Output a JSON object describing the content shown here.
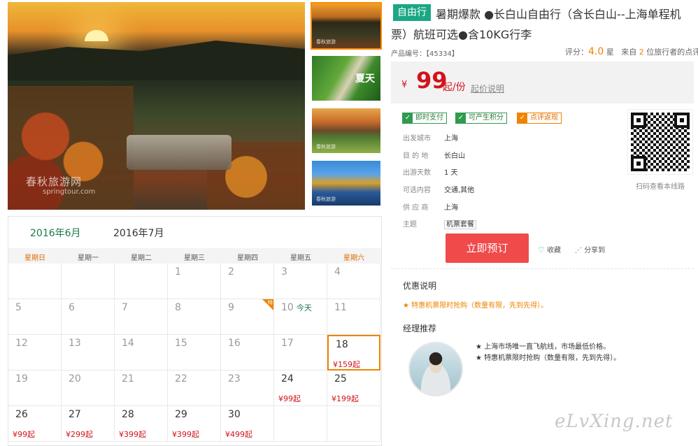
{
  "gallery": {
    "main_watermark": "春秋旅游网",
    "main_watermark_sub": "springtour.com",
    "thumbs": [
      {
        "name": "sunset-mountain",
        "wm": "春秋旅游"
      },
      {
        "name": "forest-boardwalk",
        "wm": "",
        "text": "夏天"
      },
      {
        "name": "golf-field",
        "wm": "春秋旅游"
      },
      {
        "name": "autumn-lake",
        "wm": "春秋旅游"
      }
    ]
  },
  "product": {
    "tag": "自由行",
    "title": "暑期爆款 ●长白山自由行（含长白山--上海单程机票）航班可选●含10KG行李",
    "id_label": "产品编号：【45334】",
    "rating_label": "评分：",
    "rating_value": "4.0",
    "rating_unit": "星",
    "rating_from": "来自",
    "rating_count": "2",
    "rating_suffix": "位旅行者的点评"
  },
  "price": {
    "currency": "¥",
    "amount": "99",
    "unit": "起/份",
    "explain_link": "起价说明"
  },
  "badges": [
    {
      "label": "即时支付",
      "color": "green"
    },
    {
      "label": "可产生积分",
      "color": "green"
    },
    {
      "label": "点评返现",
      "color": "orange"
    }
  ],
  "info": [
    {
      "key": "出发城市",
      "value": "上海"
    },
    {
      "key": "目 的 地",
      "value": "长白山"
    },
    {
      "key": "出游天数",
      "value": "1 天"
    },
    {
      "key": "可选内容",
      "value": "交通,其他"
    },
    {
      "key": "供 应 商",
      "value": "上海"
    },
    {
      "key": "主题",
      "value": "机票套餐"
    }
  ],
  "qr_label": "扫码查看本线路",
  "actions": {
    "book": "立即预订",
    "favorite": "收藏",
    "share": "分享到"
  },
  "promo": {
    "title": "优惠说明",
    "text": "★ 特惠机票限时抢购（数量有限，先到先得）。"
  },
  "manager": {
    "title": "经理推荐",
    "lines": [
      "★ 上海市场唯一直飞航线，市场最低价格。",
      "★ 特惠机票限时抢购（数量有限，先到先得）。"
    ]
  },
  "watermark": "eLvXing.net",
  "calendar": {
    "tabs": [
      "2016年6月",
      "2016年7月"
    ],
    "active_tab": 0,
    "weekdays": [
      "星期日",
      "星期一",
      "星期二",
      "星期三",
      "星期四",
      "星期五",
      "星期六"
    ],
    "today_label": "今天",
    "hot_tag": "特",
    "rows": [
      [
        {
          "d": ""
        },
        {
          "d": ""
        },
        {
          "d": ""
        },
        {
          "d": "1"
        },
        {
          "d": "2"
        },
        {
          "d": "3"
        },
        {
          "d": "4"
        }
      ],
      [
        {
          "d": "5"
        },
        {
          "d": "6"
        },
        {
          "d": "7"
        },
        {
          "d": "8"
        },
        {
          "d": "9",
          "hot": true
        },
        {
          "d": "10",
          "today": true
        },
        {
          "d": "11"
        }
      ],
      [
        {
          "d": "12"
        },
        {
          "d": "13"
        },
        {
          "d": "14"
        },
        {
          "d": "15"
        },
        {
          "d": "16"
        },
        {
          "d": "17"
        },
        {
          "d": "18",
          "price": "¥159起",
          "selected": true
        }
      ],
      [
        {
          "d": "19"
        },
        {
          "d": "20"
        },
        {
          "d": "21"
        },
        {
          "d": "22"
        },
        {
          "d": "23"
        },
        {
          "d": "24",
          "price": "¥99起"
        },
        {
          "d": "25",
          "price": "¥199起"
        }
      ],
      [
        {
          "d": "26",
          "price": "¥99起"
        },
        {
          "d": "27",
          "price": "¥299起"
        },
        {
          "d": "28",
          "price": "¥399起"
        },
        {
          "d": "29",
          "price": "¥399起"
        },
        {
          "d": "30",
          "price": "¥499起"
        },
        {
          "d": ""
        },
        {
          "d": ""
        }
      ]
    ]
  }
}
